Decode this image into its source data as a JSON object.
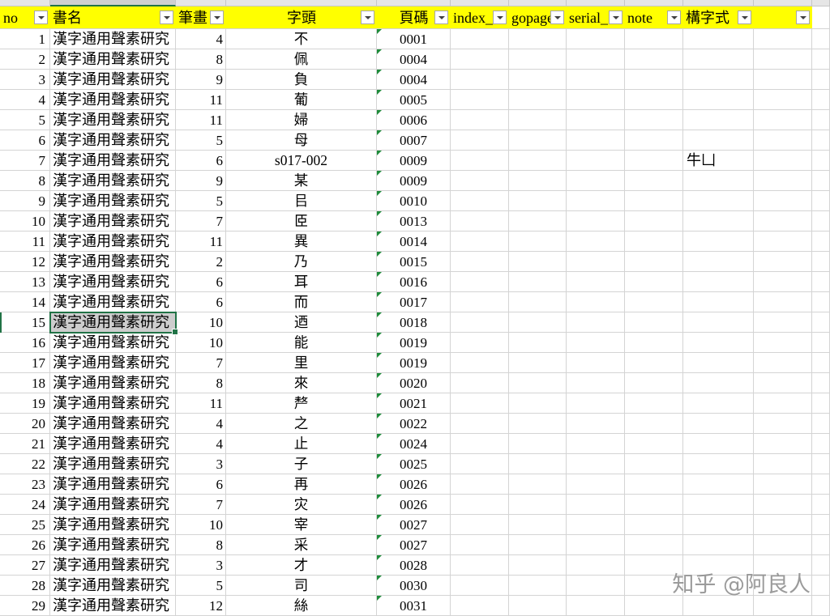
{
  "sheet": {
    "columns": [
      "no",
      "書名",
      "筆畫",
      "字頭",
      "頁碼",
      "index_",
      "gopage",
      "serial_",
      "note",
      "構字式"
    ],
    "rows": [
      {
        "no": 1,
        "book": "漢字通用聲素研究",
        "strokes": 4,
        "char": "不",
        "page": "0001"
      },
      {
        "no": 2,
        "book": "漢字通用聲素研究",
        "strokes": 8,
        "char": "佩",
        "page": "0004"
      },
      {
        "no": 3,
        "book": "漢字通用聲素研究",
        "strokes": 9,
        "char": "負",
        "page": "0004"
      },
      {
        "no": 4,
        "book": "漢字通用聲素研究",
        "strokes": 11,
        "char": "葡",
        "page": "0005"
      },
      {
        "no": 5,
        "book": "漢字通用聲素研究",
        "strokes": 11,
        "char": "婦",
        "page": "0006"
      },
      {
        "no": 6,
        "book": "漢字通用聲素研究",
        "strokes": 5,
        "char": "母",
        "page": "0007"
      },
      {
        "no": 7,
        "book": "漢字通用聲素研究",
        "strokes": 6,
        "char": "s017-002",
        "page": "0009",
        "formula": "牛凵"
      },
      {
        "no": 8,
        "book": "漢字通用聲素研究",
        "strokes": 9,
        "char": "某",
        "page": "0009"
      },
      {
        "no": 9,
        "book": "漢字通用聲素研究",
        "strokes": 5,
        "char": "㠯",
        "page": "0010"
      },
      {
        "no": 10,
        "book": "漢字通用聲素研究",
        "strokes": 7,
        "char": "𦣞",
        "page": "0013"
      },
      {
        "no": 11,
        "book": "漢字通用聲素研究",
        "strokes": 11,
        "char": "異",
        "page": "0014"
      },
      {
        "no": 12,
        "book": "漢字通用聲素研究",
        "strokes": 2,
        "char": "乃",
        "page": "0015"
      },
      {
        "no": 13,
        "book": "漢字通用聲素研究",
        "strokes": 6,
        "char": "耳",
        "page": "0016"
      },
      {
        "no": 14,
        "book": "漢字通用聲素研究",
        "strokes": 6,
        "char": "而",
        "page": "0017"
      },
      {
        "no": 15,
        "book": "漢字通用聲素研究",
        "strokes": 10,
        "char": "迺",
        "page": "0018"
      },
      {
        "no": 16,
        "book": "漢字通用聲素研究",
        "strokes": 10,
        "char": "能",
        "page": "0019"
      },
      {
        "no": 17,
        "book": "漢字通用聲素研究",
        "strokes": 7,
        "char": "里",
        "page": "0019"
      },
      {
        "no": 18,
        "book": "漢字通用聲素研究",
        "strokes": 8,
        "char": "來",
        "page": "0020"
      },
      {
        "no": 19,
        "book": "漢字通用聲素研究",
        "strokes": 11,
        "char": "𠩺",
        "page": "0021"
      },
      {
        "no": 20,
        "book": "漢字通用聲素研究",
        "strokes": 4,
        "char": "之",
        "page": "0022"
      },
      {
        "no": 21,
        "book": "漢字通用聲素研究",
        "strokes": 4,
        "char": "止",
        "page": "0024"
      },
      {
        "no": 22,
        "book": "漢字通用聲素研究",
        "strokes": 3,
        "char": "子",
        "page": "0025"
      },
      {
        "no": 23,
        "book": "漢字通用聲素研究",
        "strokes": 6,
        "char": "再",
        "page": "0026"
      },
      {
        "no": 24,
        "book": "漢字通用聲素研究",
        "strokes": 7,
        "char": "灾",
        "page": "0026"
      },
      {
        "no": 25,
        "book": "漢字通用聲素研究",
        "strokes": 10,
        "char": "宰",
        "page": "0027"
      },
      {
        "no": 26,
        "book": "漢字通用聲素研究",
        "strokes": 8,
        "char": "采",
        "page": "0027"
      },
      {
        "no": 27,
        "book": "漢字通用聲素研究",
        "strokes": 3,
        "char": "才",
        "page": "0028"
      },
      {
        "no": 28,
        "book": "漢字通用聲素研究",
        "strokes": 5,
        "char": "司",
        "page": "0030"
      },
      {
        "no": 29,
        "book": "漢字通用聲素研究",
        "strokes": 12,
        "char": "絲",
        "page": "0031"
      }
    ]
  },
  "watermark": "知乎 @阿良人",
  "colors": {
    "header_fill": "#ffff00",
    "selection": "#217346",
    "gridline": "#d4d4d4",
    "text_number_indicator": "#1f8c3b"
  }
}
